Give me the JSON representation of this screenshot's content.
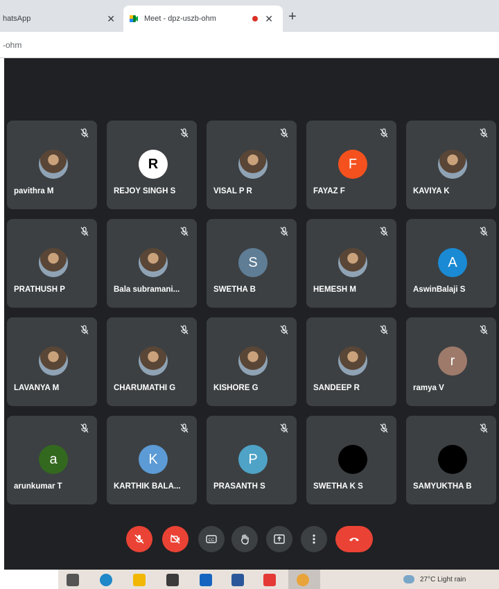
{
  "browser": {
    "tabs": [
      {
        "title": "hatsApp",
        "close": "✕"
      },
      {
        "title": "Meet - dpz-uszb-ohm",
        "close": "✕"
      }
    ],
    "new_tab": "+",
    "url": "-ohm"
  },
  "participants": [
    {
      "name": "pavithra M",
      "avatar_type": "photo"
    },
    {
      "name": "REJOY SINGH S",
      "avatar_type": "letter",
      "letter": "R",
      "color": "#ffffff",
      "letter_color": "#000000"
    },
    {
      "name": "VISAL P R",
      "avatar_type": "photo"
    },
    {
      "name": "FAYAZ F",
      "avatar_type": "letter",
      "letter": "F",
      "color": "#f4511e",
      "letter_color": "#ffffff"
    },
    {
      "name": "KAVIYA K",
      "avatar_type": "photo"
    },
    {
      "name": "PRATHUSH P",
      "avatar_type": "photo"
    },
    {
      "name": "Bala subramani...",
      "avatar_type": "photo"
    },
    {
      "name": "SWETHA B",
      "avatar_type": "letter",
      "letter": "S",
      "color": "#5f7d95",
      "letter_color": "#ffffff"
    },
    {
      "name": "HEMESH M",
      "avatar_type": "photo"
    },
    {
      "name": "AswinBalaji S",
      "avatar_type": "letter",
      "letter": "A",
      "color": "#1a8ad4",
      "letter_color": "#ffffff"
    },
    {
      "name": "LAVANYA M",
      "avatar_type": "photo"
    },
    {
      "name": "CHARUMATHI G",
      "avatar_type": "photo"
    },
    {
      "name": "KISHORE G",
      "avatar_type": "photo"
    },
    {
      "name": "SANDEEP R",
      "avatar_type": "photo"
    },
    {
      "name": "ramya V",
      "avatar_type": "letter",
      "letter": "r",
      "color": "#9e7a6b",
      "letter_color": "#ffffff"
    },
    {
      "name": "arunkumar T",
      "avatar_type": "letter",
      "letter": "a",
      "color": "#33691e",
      "letter_color": "#ffffff"
    },
    {
      "name": "KARTHIK BALA...",
      "avatar_type": "letter",
      "letter": "K",
      "color": "#5c9bd5",
      "letter_color": "#ffffff"
    },
    {
      "name": "PRASANTH S",
      "avatar_type": "letter",
      "letter": "P",
      "color": "#4fa3c7",
      "letter_color": "#ffffff"
    },
    {
      "name": "SWETHA K S",
      "avatar_type": "blank",
      "color": "#000000"
    },
    {
      "name": "SAMYUKTHA B",
      "avatar_type": "blank",
      "color": "#000000"
    }
  ],
  "controls": [
    {
      "name": "mic-toggle-button",
      "icon": "mic-off-icon",
      "style": "red"
    },
    {
      "name": "camera-toggle-button",
      "icon": "camera-off-icon",
      "style": "red"
    },
    {
      "name": "captions-button",
      "icon": "captions-icon",
      "style": "gray"
    },
    {
      "name": "raise-hand-button",
      "icon": "hand-icon",
      "style": "gray"
    },
    {
      "name": "present-button",
      "icon": "present-icon",
      "style": "gray"
    },
    {
      "name": "more-options-button",
      "icon": "more-vert-icon",
      "style": "gray"
    },
    {
      "name": "leave-call-button",
      "icon": "call-end-icon",
      "style": "end"
    }
  ],
  "taskbar": {
    "weather": "27°C  Light rain",
    "icons": [
      {
        "name": "task-view-icon",
        "color": "#555555"
      },
      {
        "name": "edge-icon",
        "color": "#1e88c8"
      },
      {
        "name": "file-explorer-icon",
        "color": "#f2b705"
      },
      {
        "name": "store-icon",
        "color": "#3b3b3b"
      },
      {
        "name": "mail-icon",
        "color": "#1565c0"
      },
      {
        "name": "word-icon",
        "color": "#2b579a"
      },
      {
        "name": "acrobat-icon",
        "color": "#e53935"
      },
      {
        "name": "chrome-icon",
        "color": "#e8a43a"
      }
    ]
  }
}
